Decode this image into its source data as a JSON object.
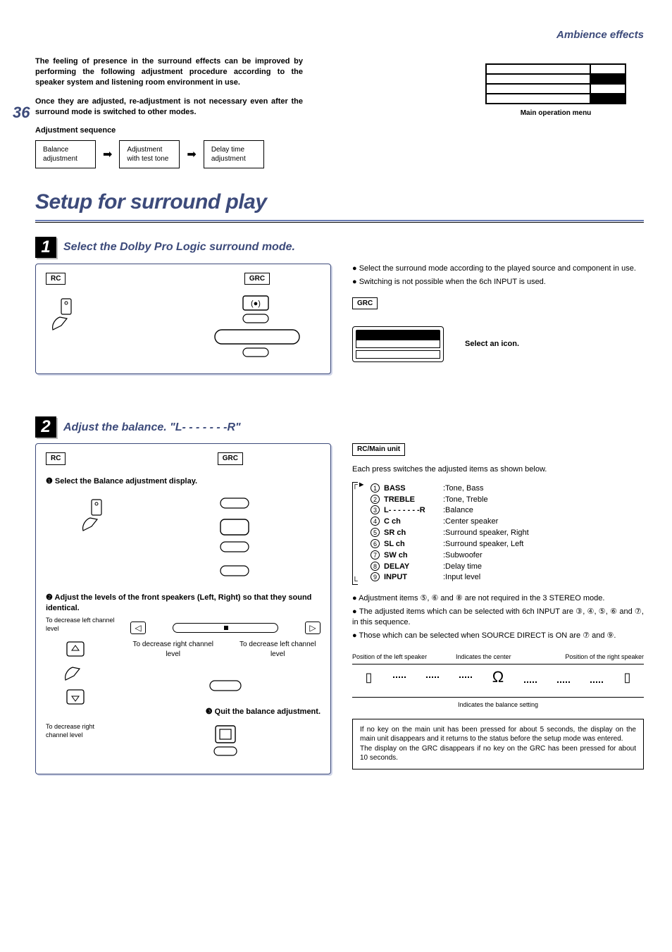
{
  "header": {
    "section": "Ambience effects",
    "page": "36"
  },
  "intro": {
    "p1": "The feeling of presence in the surround effects can be improved by performing the following adjustment procedure according to the speaker system and listening room environment in use.",
    "p2": "Once they are adjusted, re-adjustment is not necessary even after the surround mode is switched to other modes."
  },
  "adjSeq": {
    "label": "Adjustment sequence",
    "b1a": "Balance",
    "b1b": "adjustment",
    "b2a": "Adjustment",
    "b2b": "with test tone",
    "b3a": "Delay time",
    "b3b": "adjustment"
  },
  "menu": {
    "caption": "Main operation menu"
  },
  "title": "Setup for surround play",
  "step1": {
    "num": "1",
    "title": "Select the Dolby Pro Logic surround mode.",
    "rc": "RC",
    "grc": "GRC",
    "bul1": "Select the surround mode according to the played source and component in use.",
    "bul2": "Switching is not possible when the 6ch INPUT is used.",
    "selicon": "Select an icon."
  },
  "step2": {
    "num": "2",
    "title": "Adjust the balance. \"L- - - - - - -R\"",
    "rc": "RC",
    "grc": "GRC",
    "sub1": "Select the Balance adjustment display.",
    "sub2": "Adjust the levels of the front speakers (Left, Right) so that they sound identical.",
    "sub3": "Quit the balance adjustment.",
    "decL": "To decrease left channel level",
    "decR": "To decrease right channel level",
    "rcmain": "RC/Main unit",
    "eachpress": "Each press switches the adjusted items as shown below.",
    "items": [
      {
        "n": "1",
        "k": "BASS",
        "v": ":Tone, Bass"
      },
      {
        "n": "2",
        "k": "TREBLE",
        "v": ":Tone, Treble"
      },
      {
        "n": "3",
        "k": "L- - - - - - -R",
        "v": ":Balance"
      },
      {
        "n": "4",
        "k": "C ch",
        "v": ":Center speaker"
      },
      {
        "n": "5",
        "k": "SR ch",
        "v": ":Surround speaker, Right"
      },
      {
        "n": "6",
        "k": "SL ch",
        "v": ":Surround speaker, Left"
      },
      {
        "n": "7",
        "k": "SW ch",
        "v": ":Subwoofer"
      },
      {
        "n": "8",
        "k": "DELAY",
        "v": ":Delay time"
      },
      {
        "n": "9",
        "k": "INPUT",
        "v": ":Input level"
      }
    ],
    "note1": "Adjustment items ⑤, ⑥ and ⑧ are not required in the 3 STEREO mode.",
    "note2": "The adjusted items which can be selected with 6ch INPUT are ③, ④, ⑤, ⑥ and ⑦, in this sequence.",
    "note3": "Those which can be selected when SOURCE DIRECT is ON are ⑦ and ⑨.",
    "posL": "Position of the left speaker",
    "posC": "Indicates the center",
    "posR": "Position of the right speaker",
    "balsetting": "Indicates the balance setting",
    "box1": "If no key on the main unit has been pressed for about 5 seconds, the display on the main unit disappears and it returns to the status before the setup mode was entered.",
    "box2": "The display on the GRC disappears if no key on the GRC has been pressed for about 10 seconds."
  }
}
